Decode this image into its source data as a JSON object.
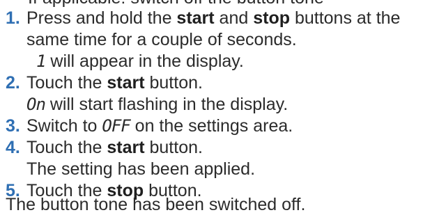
{
  "clipped_top_text": "If applicable: switch off the button tone",
  "steps": [
    {
      "num": "1.",
      "line1_a": "Press and hold the ",
      "line1_b": "start",
      "line1_c": " and ",
      "line1_d": "stop",
      "line1_e": " buttons at the",
      "line2": "same time for a couple of seconds.",
      "result_symbol": "1",
      "result_text": " will appear in the display."
    },
    {
      "num": "2.",
      "line1_a": "Touch the ",
      "line1_b": "start",
      "line1_c": " button.",
      "result_symbol": "On",
      "result_text": " will start flashing in the display."
    },
    {
      "num": "3.",
      "line1_a": "Switch to ",
      "line1_symbol": "OFF",
      "line1_c": " on the settings area."
    },
    {
      "num": "4.",
      "line1_a": "Touch the ",
      "line1_b": "start",
      "line1_c": " button.",
      "line2": "The setting has been applied."
    },
    {
      "num": "5.",
      "line1_a": "Touch the ",
      "line1_b": "stop",
      "line1_c": " button."
    }
  ],
  "final_text": "The button tone has been switched off."
}
